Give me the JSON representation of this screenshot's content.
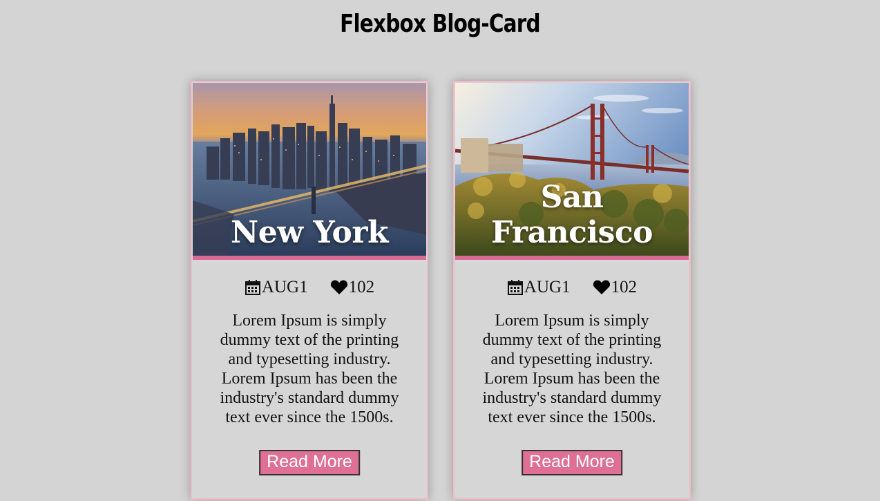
{
  "page": {
    "title": "Flexbox Blog-Card"
  },
  "cards": [
    {
      "title": "New York",
      "date": "AUG1",
      "likes": "102",
      "body": "Lorem Ipsum is simply dummy text of the printing and typesetting industry. Lorem Ipsum has been the industry's standard dummy text ever since the 1500s.",
      "button_label": "Read More",
      "image": "new-york-skyline-photo"
    },
    {
      "title": "San Francisco",
      "date": "AUG1",
      "likes": "102",
      "body": "Lorem Ipsum is simply dummy text of the printing and typesetting industry. Lorem Ipsum has been the industry's standard dummy text ever since the 1500s.",
      "button_label": "Read More",
      "image": "golden-gate-bridge-photo"
    }
  ],
  "icons": {
    "date": "calendar-icon",
    "likes": "heart-icon"
  },
  "colors": {
    "background": "#d4d4d4",
    "accent": "#df6f94",
    "card_border": "#f3b9c8"
  }
}
